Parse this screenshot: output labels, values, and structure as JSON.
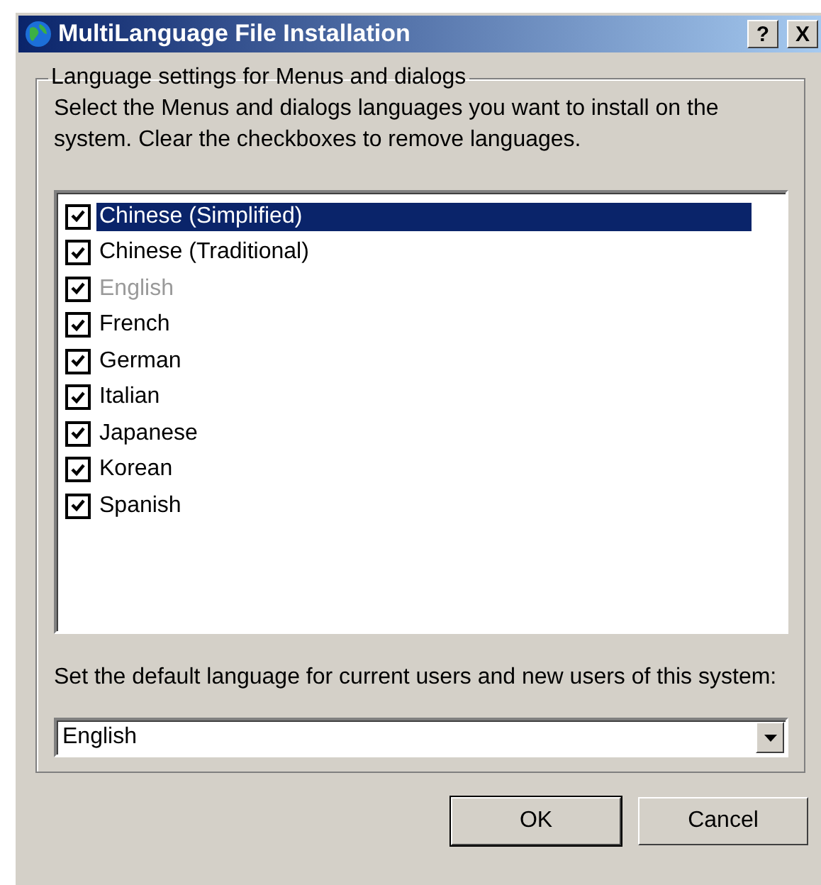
{
  "window": {
    "title": "MultiLanguage File Installation",
    "buttons": [
      "?",
      "X"
    ]
  },
  "group": {
    "legend": "Language settings for Menus and dialogs",
    "description": "Select the Menus and dialogs languages you want to install on the system. Clear the checkboxes to remove languages."
  },
  "languages": [
    {
      "label": "Chinese (Simplified)",
      "checked": true,
      "disabled": false,
      "selected": true
    },
    {
      "label": "Chinese (Traditional)",
      "checked": true,
      "disabled": false,
      "selected": false
    },
    {
      "label": "English",
      "checked": true,
      "disabled": true,
      "selected": false
    },
    {
      "label": "French",
      "checked": true,
      "disabled": false,
      "selected": false
    },
    {
      "label": "German",
      "checked": true,
      "disabled": false,
      "selected": false
    },
    {
      "label": "Italian",
      "checked": true,
      "disabled": false,
      "selected": false
    },
    {
      "label": "Japanese",
      "checked": true,
      "disabled": false,
      "selected": false
    },
    {
      "label": "Korean",
      "checked": true,
      "disabled": false,
      "selected": false
    },
    {
      "label": "Spanish",
      "checked": true,
      "disabled": false,
      "selected": false
    }
  ],
  "default_language": {
    "label": "Set the default language for current users and new users of this system:",
    "value": "English"
  },
  "buttons": [
    "OK",
    "Cancel"
  ]
}
